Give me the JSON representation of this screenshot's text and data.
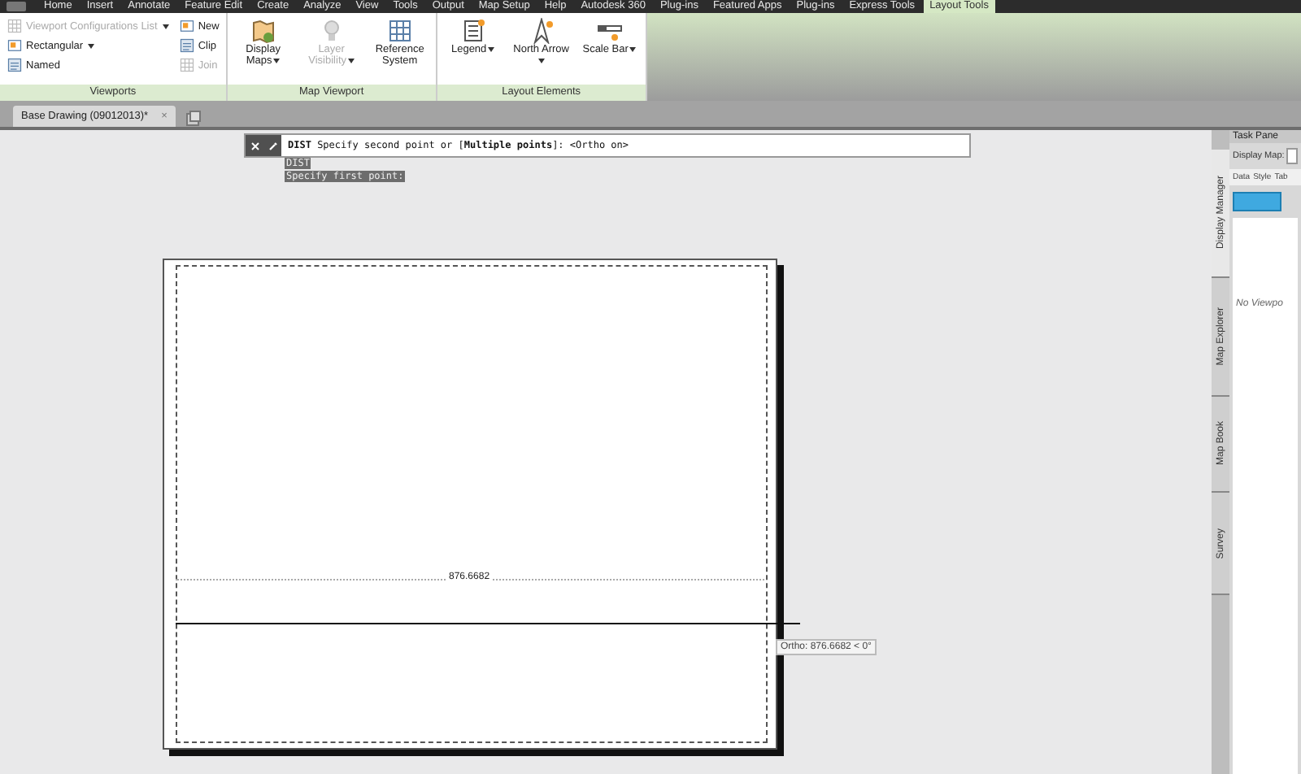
{
  "menu_tabs": [
    {
      "label": "Home",
      "selected": false
    },
    {
      "label": "Insert",
      "selected": false
    },
    {
      "label": "Annotate",
      "selected": false
    },
    {
      "label": "Feature Edit",
      "selected": false
    },
    {
      "label": "Create",
      "selected": false
    },
    {
      "label": "Analyze",
      "selected": false
    },
    {
      "label": "View",
      "selected": false
    },
    {
      "label": "Tools",
      "selected": false
    },
    {
      "label": "Output",
      "selected": false
    },
    {
      "label": "Map Setup",
      "selected": false
    },
    {
      "label": "Help",
      "selected": false
    },
    {
      "label": "Autodesk 360",
      "selected": false
    },
    {
      "label": "Plug-ins",
      "selected": false
    },
    {
      "label": "Featured Apps",
      "selected": false
    },
    {
      "label": "Plug-ins",
      "selected": false
    },
    {
      "label": "Express Tools",
      "selected": false
    },
    {
      "label": "Layout Tools",
      "selected": true
    }
  ],
  "ribbon_panels": [
    {
      "title": "Viewports",
      "columns": [
        [
          {
            "label": "Viewport Configurations List",
            "kind": "grid",
            "disabled": true,
            "dropdown": true
          },
          {
            "label": "Rectangular",
            "kind": "rect",
            "disabled": false,
            "dropdown": true
          },
          {
            "label": "Named",
            "kind": "list",
            "disabled": false,
            "dropdown": false
          }
        ],
        [
          {
            "label": "New",
            "kind": "rect",
            "disabled": false,
            "dropdown": false
          },
          {
            "label": "Clip",
            "kind": "list",
            "disabled": false,
            "dropdown": false
          },
          {
            "label": "Join",
            "kind": "grid",
            "disabled": true,
            "dropdown": false
          }
        ]
      ]
    },
    {
      "title": "Map Viewport",
      "large": [
        {
          "label": "Display Maps",
          "kind": "map",
          "disabled": false,
          "dropdown": true
        },
        {
          "label": "Layer Visibility",
          "kind": "bulb",
          "disabled": true,
          "dropdown": true
        },
        {
          "label": "Reference System",
          "kind": "grid",
          "disabled": false,
          "dropdown": false
        }
      ]
    },
    {
      "title": "Layout Elements",
      "large": [
        {
          "label": "Legend",
          "kind": "legend",
          "disabled": false,
          "dropdown": true
        },
        {
          "label": "North Arrow",
          "kind": "arrow",
          "disabled": false,
          "dropdown": true
        },
        {
          "label": "Scale Bar",
          "kind": "scale",
          "disabled": false,
          "dropdown": true
        }
      ]
    }
  ],
  "document_tab": {
    "title": "Base Drawing (09012013)*",
    "close": "×"
  },
  "command_line": {
    "prompt": "**DIST** Specify second point or [**Multiple points**]:  <Ortho on>",
    "history": [
      "DIST",
      "Specify first point:"
    ]
  },
  "drawing": {
    "dimension": "876.6682",
    "tooltip": "Ortho: 876.6682 < 0°"
  },
  "task_pane": {
    "title": "Task Pane",
    "side_tabs": [
      {
        "label": "Display Manager",
        "selected": true
      },
      {
        "label": "Map Explorer",
        "selected": false
      },
      {
        "label": "Map Book",
        "selected": false
      },
      {
        "label": "Survey",
        "selected": false
      }
    ],
    "map_label": "Display Map:",
    "tools": [
      "Data",
      "Style",
      "Tab"
    ],
    "message": "No Viewpo"
  }
}
